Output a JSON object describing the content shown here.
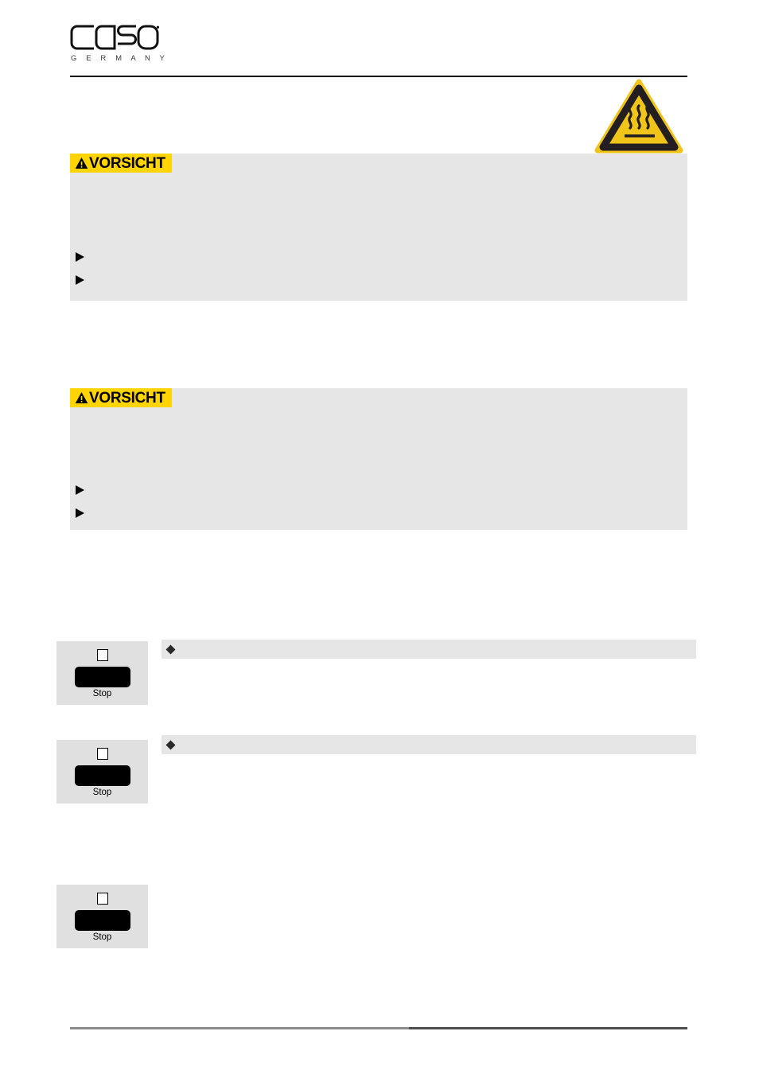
{
  "document": {
    "brand": "CASO",
    "brand_sub": "G E R M A N Y",
    "page_background": "#ffffff"
  },
  "header": {
    "logo_name": "caso-logo",
    "rule_color": "#000000"
  },
  "pictogram": {
    "name": "hot-surface-warning-icon",
    "triangle_fill": "#f0c419",
    "triangle_border": "#231f20",
    "description": "hot surface"
  },
  "warnings": [
    {
      "tag_label": "VORSICHT",
      "tag_background": "#ffd400",
      "tag_icon": "warning-triangle-icon",
      "box_background": "#e6e6e6",
      "body": "",
      "bullets": [
        {
          "marker": "arrow-right-icon",
          "text": ""
        },
        {
          "marker": "arrow-right-icon",
          "text": ""
        }
      ]
    },
    {
      "tag_label": "VORSICHT",
      "tag_background": "#ffd400",
      "tag_icon": "warning-triangle-icon",
      "box_background": "#e6e6e6",
      "body": "",
      "bullets": [
        {
          "marker": "arrow-right-icon",
          "text": ""
        },
        {
          "marker": "arrow-right-icon",
          "text": ""
        }
      ]
    }
  ],
  "control_figures": [
    {
      "indicator": "square-indicator-icon",
      "key": "stop-key",
      "label": "Stop"
    },
    {
      "indicator": "square-indicator-icon",
      "key": "stop-key",
      "label": "Stop"
    },
    {
      "indicator": "square-indicator-icon",
      "key": "stop-key",
      "label": "Stop"
    }
  ],
  "notes": [
    {
      "marker": "diamond-bullet-icon",
      "heading": "",
      "body": ""
    },
    {
      "marker": "diamond-bullet-icon",
      "heading": "",
      "body": ""
    },
    {
      "marker": "",
      "heading": "",
      "body": ""
    }
  ],
  "footer": {
    "rule_left_color": "#8c8c8c",
    "rule_right_color": "#4d4d4d",
    "left_text": "",
    "right_text": ""
  }
}
